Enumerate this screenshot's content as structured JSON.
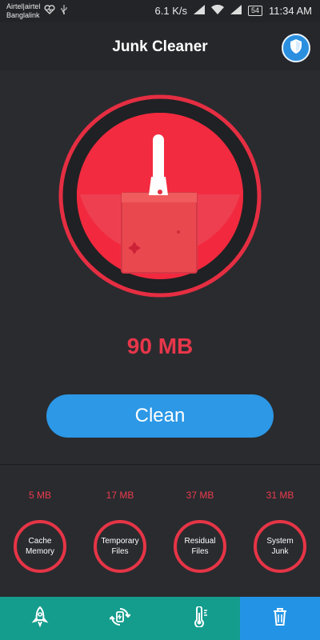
{
  "status": {
    "carrier_1": "Airtel|airtel",
    "carrier_2": "Banglalink",
    "network_speed": "6.1 K/s",
    "battery": "54",
    "time": "11:34 AM"
  },
  "header": {
    "title": "Junk Cleaner"
  },
  "main": {
    "junk_size": "90 MB",
    "clean_label": "Clean"
  },
  "stats": [
    {
      "size": "5 MB",
      "label": "Cache Memory"
    },
    {
      "size": "17 MB",
      "label": "Temporary Files"
    },
    {
      "size": "37 MB",
      "label": "Residual Files"
    },
    {
      "size": "31 MB",
      "label": "System Junk"
    }
  ],
  "nav": {
    "items": [
      {
        "icon": "rocket-icon"
      },
      {
        "icon": "cpu-cooler-icon"
      },
      {
        "icon": "thermometer-icon"
      },
      {
        "icon": "trash-icon"
      }
    ]
  },
  "colors": {
    "accent_red": "#e63546",
    "clean_blue": "#2c98e6",
    "nav_teal": "#149d8d",
    "nav_active_blue": "#2393e5",
    "background": "#2a2b2f"
  }
}
